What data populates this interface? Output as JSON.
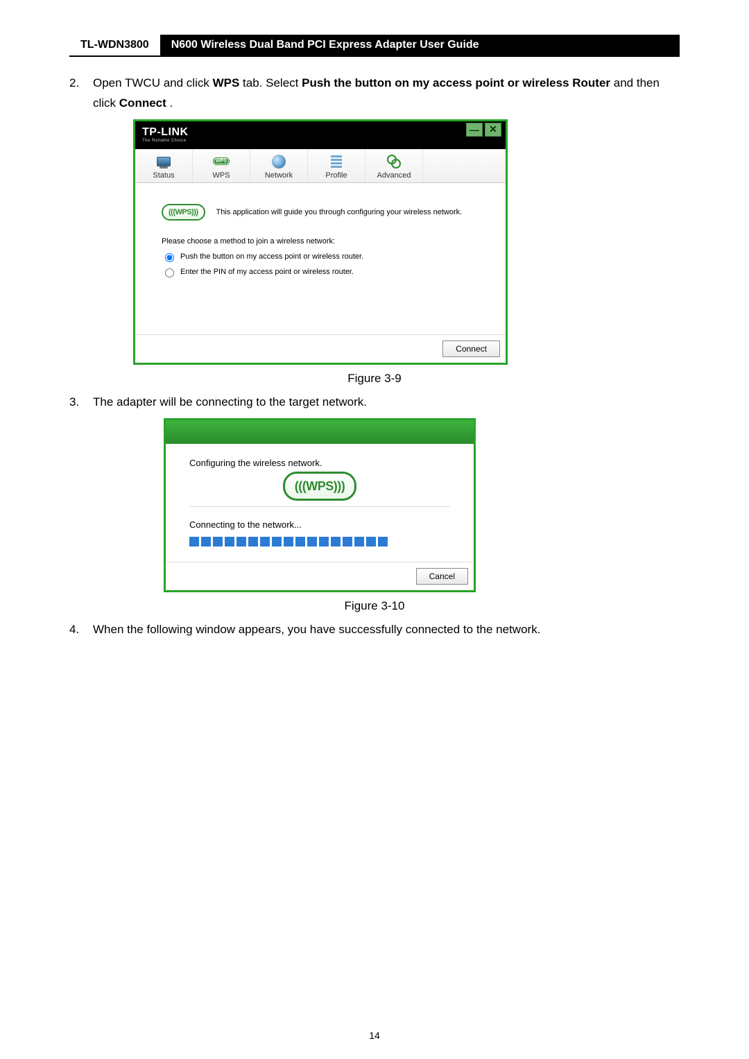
{
  "header": {
    "model": "TL-WDN3800",
    "title": "N600 Wireless Dual Band PCI Express Adapter User Guide"
  },
  "steps": {
    "s2": {
      "num": "2.",
      "pre": "Open TWCU and click ",
      "b1": "WPS",
      "mid1": " tab. Select ",
      "b2": "Push the button on my access point or wireless Router",
      "mid2": " and then click ",
      "b3": "Connect",
      "post": "."
    },
    "s3": {
      "num": "3.",
      "text": "The adapter will be connecting to the target network."
    },
    "s4": {
      "num": "4.",
      "text": "When the following window appears, you have successfully connected to the network."
    }
  },
  "twsu": {
    "logo": "TP-LINK",
    "logo_sub": "The Reliable Choice",
    "win": {
      "min": "—",
      "close": "✕"
    },
    "tabs": {
      "status": "Status",
      "wps": "WPS",
      "network": "Network",
      "profile": "Profile",
      "advanced": "Advanced"
    },
    "wps_label": "(((WPS)))",
    "intro": "This application will guide you through configuring your wireless network.",
    "choose": "Please choose a method to join a wireless network:",
    "opt1": "Push the button on my access point or wireless router.",
    "opt2": "Enter the PIN of my access point or wireless router.",
    "connect_btn": "Connect"
  },
  "dlg": {
    "line1": "Configuring the wireless network.",
    "wps_label": "(((WPS)))",
    "line2": "Connecting to the network...",
    "cancel_btn": "Cancel"
  },
  "captions": {
    "fig1": "Figure 3-9",
    "fig2": "Figure 3-10"
  },
  "page_number": "14"
}
